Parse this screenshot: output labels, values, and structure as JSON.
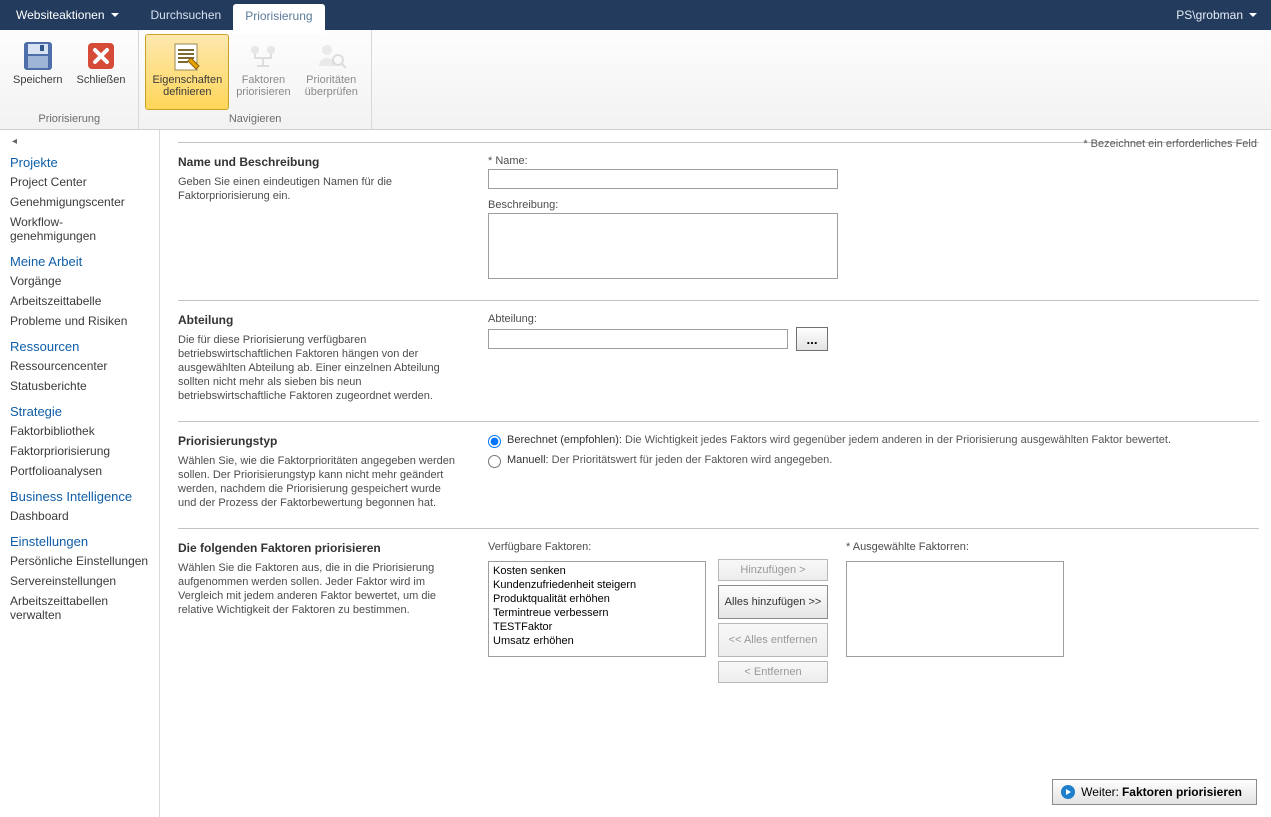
{
  "header": {
    "site_actions": "Websiteaktionen",
    "tabs": {
      "browse": "Durchsuchen",
      "prio": "Priorisierung"
    },
    "user": "PS\\grobman"
  },
  "ribbon": {
    "group_prio": "Priorisierung",
    "group_nav": "Navigieren",
    "save": "Speichern",
    "close": "Schließen",
    "props_l1": "Eigenschaften",
    "props_l2": "definieren",
    "factors_l1": "Faktoren",
    "factors_l2": "priorisieren",
    "prios_l1": "Prioritäten",
    "prios_l2": "überprüfen"
  },
  "nav": {
    "projects": {
      "head": "Projekte",
      "items": [
        "Project Center",
        "Genehmigungscenter",
        "Workflow-genehmigungen"
      ]
    },
    "work": {
      "head": "Meine Arbeit",
      "items": [
        "Vorgänge",
        "Arbeitszeittabelle",
        "Probleme und Risiken"
      ]
    },
    "res": {
      "head": "Ressourcen",
      "items": [
        "Ressourcencenter",
        "Statusberichte"
      ]
    },
    "strat": {
      "head": "Strategie",
      "items": [
        "Faktorbibliothek",
        "Faktorpriorisierung",
        "Portfolioanalysen"
      ]
    },
    "bi": {
      "head": "Business Intelligence",
      "items": [
        "Dashboard"
      ]
    },
    "settings": {
      "head": "Einstellungen",
      "items": [
        "Persönliche Einstellungen",
        "Servereinstellungen",
        "Arbeitszeittabellen verwalten"
      ]
    }
  },
  "content": {
    "required_note": "* Bezeichnet ein erforderliches Feld",
    "sec1": {
      "heading": "Name und Beschreibung",
      "desc": "Geben Sie einen eindeutigen Namen für die Faktorpriorisierung ein.",
      "name_label": "* Name:",
      "name_value": "",
      "desc_label": "Beschreibung:",
      "desc_value": ""
    },
    "sec2": {
      "heading": "Abteilung",
      "desc": "Die für diese Priorisierung verfügbaren betriebswirtschaftlichen Faktoren hängen von der ausgewählten Abteilung ab. Einer einzelnen Abteilung sollten nicht mehr als sieben bis neun betriebswirtschaftliche Faktoren zugeordnet werden.",
      "dept_label": "Abteilung:",
      "dept_value": "",
      "browse": "..."
    },
    "sec3": {
      "heading": "Priorisierungstyp",
      "desc": "Wählen Sie, wie die Faktorprioritäten angegeben werden sollen. Der Priorisierungstyp kann nicht mehr geändert werden, nachdem die Priorisierung gespeichert wurde und der Prozess der Faktorbewertung begonnen hat.",
      "opt1_strong": "Berechnet (empfohlen):",
      "opt1_rest": " Die Wichtigkeit jedes Faktors wird gegenüber jedem anderen in der Priorisierung ausgewählten Faktor bewertet.",
      "opt2_strong": "Manuell:",
      "opt2_rest": " Der Prioritätswert für jeden der Faktoren wird angegeben."
    },
    "sec4": {
      "heading": "Die folgenden Faktoren priorisieren",
      "desc": "Wählen Sie die Faktoren aus, die in die Priorisierung aufgenommen werden sollen. Jeder Faktor wird im Vergleich mit jedem anderen Faktor bewertet, um die relative Wichtigkeit der Faktoren zu bestimmen.",
      "avail_label": "Verfügbare Faktoren:",
      "selected_label": "* Ausgewählte Faktorren:",
      "available": [
        "Kosten senken",
        "Kundenzufriedenheit steigern",
        "Produktqualität erhöhen",
        "Termintreue verbessern",
        "TESTFaktor",
        "Umsatz erhöhen"
      ],
      "btn_add": "Hinzufügen >",
      "btn_add_all": "Alles hinzufügen >>",
      "btn_remove_all": "<< Alles entfernen",
      "btn_remove": "< Entfernen"
    },
    "footer": {
      "prefix": "Weiter:",
      "strong": "Faktoren priorisieren"
    }
  }
}
